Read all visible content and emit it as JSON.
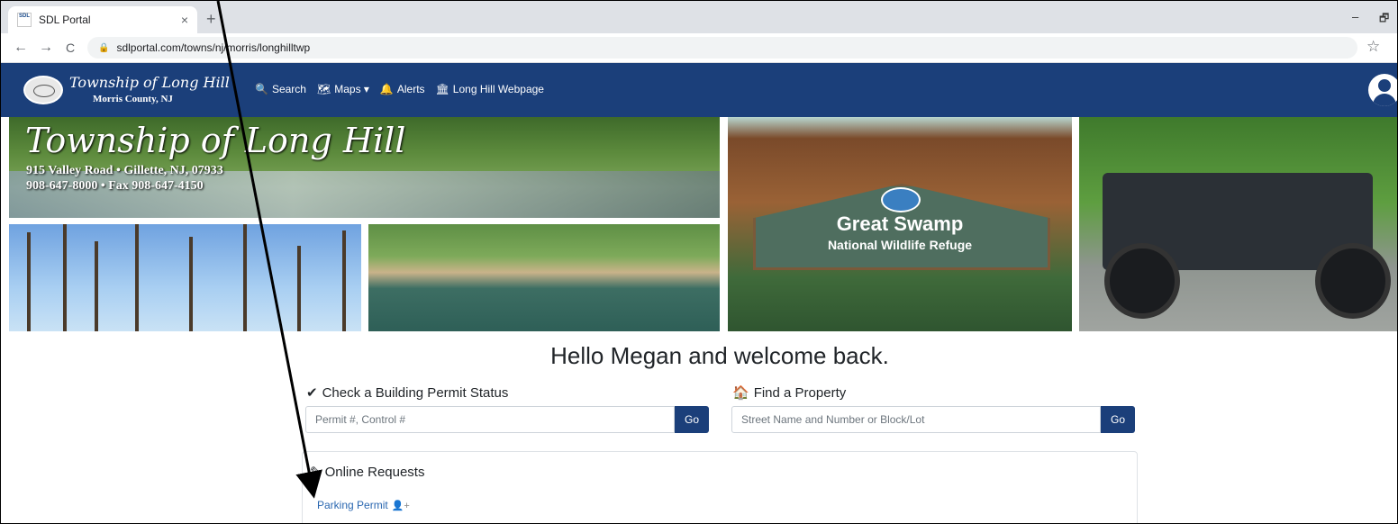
{
  "browser": {
    "tab_title": "SDL Portal",
    "favicon_text": "SDL",
    "tab_close": "×",
    "new_tab": "+",
    "url": "sdlportal.com/towns/nj/morris/longhilltwp",
    "back": "←",
    "forward": "→",
    "reload": "C",
    "lock": "🔒",
    "bookmark": "☆",
    "minimize": "–",
    "restore": "🗗"
  },
  "nav": {
    "brand_title": "Township of Long Hill",
    "brand_subtitle": "Morris County, NJ",
    "items": [
      {
        "label": "Search",
        "icon": "search-icon",
        "glyph": "🔍"
      },
      {
        "label": "Maps ▾",
        "icon": "map-icon",
        "glyph": "🗺"
      },
      {
        "label": "Alerts",
        "icon": "bell-icon",
        "glyph": "🔔"
      },
      {
        "label": "Long Hill Webpage",
        "icon": "building-icon",
        "glyph": "🏛"
      }
    ]
  },
  "banner": {
    "title": "Township of Long Hill",
    "address": "915 Valley Road • Gillette, NJ, 07933",
    "phone": "908-647-8000 • Fax 908-647-4150",
    "sign_line1": "Great Swamp",
    "sign_line2": "National Wildlife Refuge"
  },
  "main": {
    "greeting": "Hello Megan and welcome back.",
    "permit": {
      "label": "Check a Building Permit Status",
      "icon": "check-icon",
      "glyph": "✔",
      "placeholder": "Permit #, Control #",
      "button": "Go"
    },
    "property": {
      "label": "Find a Property",
      "icon": "home-icon",
      "glyph": "🏠",
      "placeholder": "Street Name and Number or Block/Lot",
      "button": "Go"
    },
    "online_requests": {
      "title": "Online Requests",
      "icon": "pencil-icon",
      "glyph": "✎",
      "links": [
        {
          "label": "Parking Permit",
          "icon": "user-plus-icon",
          "glyph": "👤+"
        }
      ]
    }
  },
  "colors": {
    "navbar": "#1b3f7a",
    "link": "#2a67b0",
    "button": "#1b3f7a"
  }
}
